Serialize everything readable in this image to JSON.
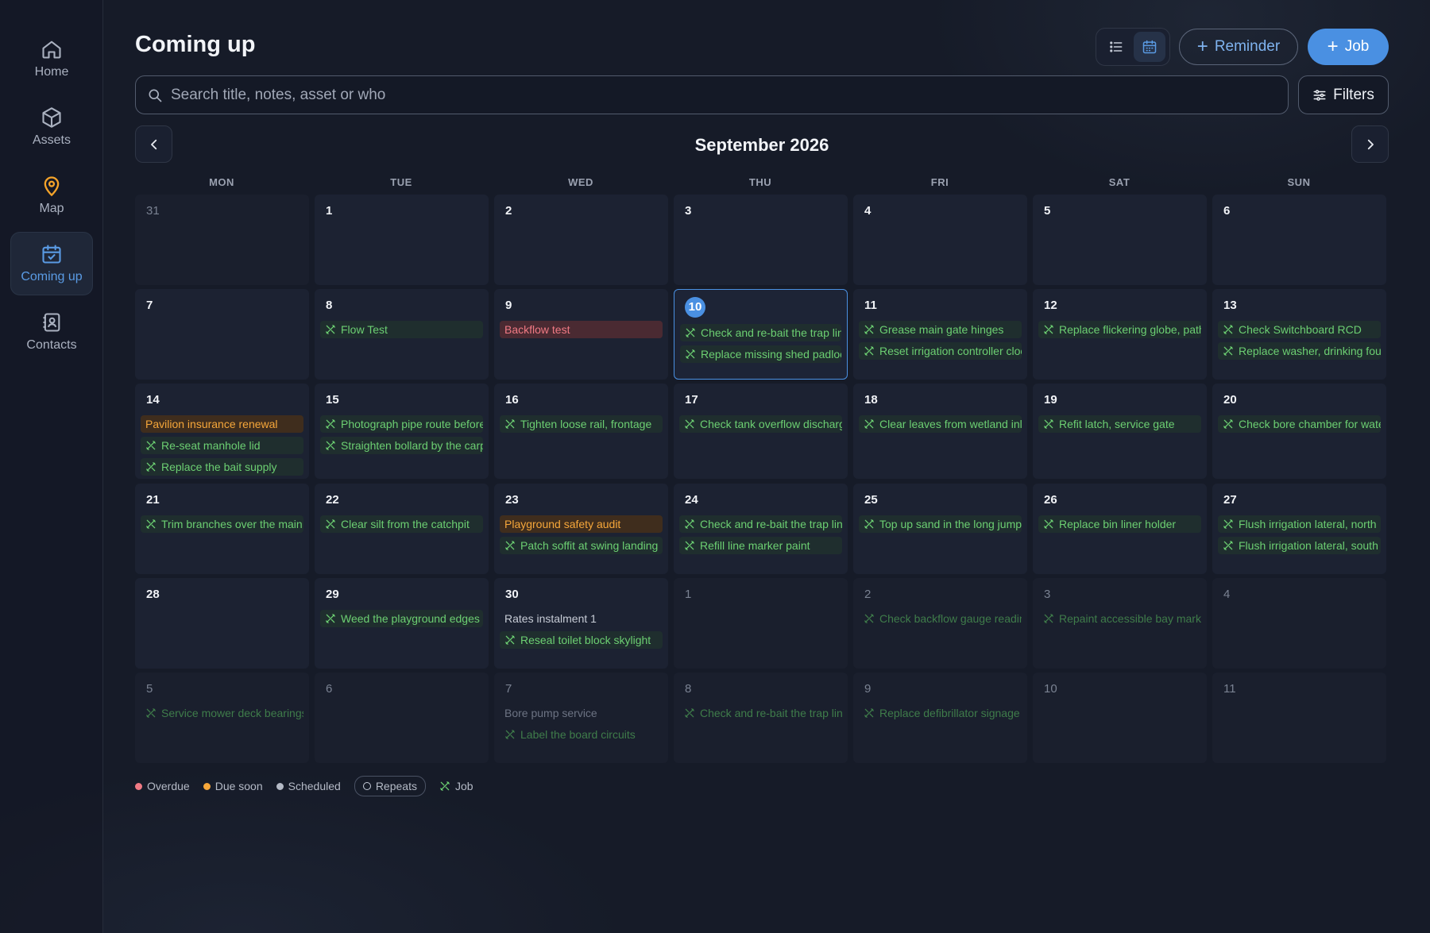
{
  "sidebar": {
    "items": [
      {
        "label": "Home",
        "icon": "home-icon"
      },
      {
        "label": "Assets",
        "icon": "box-icon"
      },
      {
        "label": "Map",
        "icon": "map-pin-icon"
      },
      {
        "label": "Coming up",
        "icon": "calendar-check-icon",
        "active": true
      },
      {
        "label": "Contacts",
        "icon": "contact-book-icon"
      }
    ]
  },
  "header": {
    "title": "Coming up",
    "reminder_label": "Reminder",
    "job_label": "Job",
    "filters_label": "Filters",
    "search_placeholder": "Search title, notes, asset or who",
    "view_modes": [
      "list",
      "calendar"
    ],
    "active_view": "calendar"
  },
  "calendar": {
    "month_label": "September 2026",
    "weekdays": [
      "MON",
      "TUE",
      "WED",
      "THU",
      "FRI",
      "SAT",
      "SUN"
    ],
    "weeks": [
      [
        {
          "d": "31",
          "dim": true,
          "ev": []
        },
        {
          "d": "1",
          "ev": []
        },
        {
          "d": "2",
          "ev": []
        },
        {
          "d": "3",
          "ev": []
        },
        {
          "d": "4",
          "ev": []
        },
        {
          "d": "5",
          "ev": []
        },
        {
          "d": "6",
          "ev": []
        }
      ],
      [
        {
          "d": "7",
          "ev": []
        },
        {
          "d": "8",
          "ev": [
            {
              "t": "Flow Test",
              "k": "job"
            }
          ]
        },
        {
          "d": "9",
          "ev": [
            {
              "t": "Backflow test",
              "k": "overdue"
            }
          ]
        },
        {
          "d": "10",
          "today": true,
          "ev": [
            {
              "t": "Check and re-bait the trap line",
              "k": "job"
            },
            {
              "t": "Replace missing shed padlock",
              "k": "job"
            }
          ]
        },
        {
          "d": "11",
          "ev": [
            {
              "t": "Grease main gate hinges",
              "k": "job"
            },
            {
              "t": "Reset irrigation controller clock",
              "k": "job"
            }
          ]
        },
        {
          "d": "12",
          "ev": [
            {
              "t": "Replace flickering globe, path",
              "k": "job"
            }
          ]
        },
        {
          "d": "13",
          "ev": [
            {
              "t": "Check Switchboard RCD",
              "k": "job"
            },
            {
              "t": "Replace washer, drinking fountain",
              "k": "job"
            }
          ]
        }
      ],
      [
        {
          "d": "14",
          "ev": [
            {
              "t": "Pavilion insurance renewal",
              "k": "due"
            },
            {
              "t": "Re-seat manhole lid",
              "k": "job"
            },
            {
              "t": "Replace the bait supply",
              "k": "job"
            }
          ]
        },
        {
          "d": "15",
          "ev": [
            {
              "t": "Photograph pipe route before",
              "k": "job"
            },
            {
              "t": "Straighten bollard by the carpark",
              "k": "job"
            }
          ]
        },
        {
          "d": "16",
          "ev": [
            {
              "t": "Tighten loose rail, frontage",
              "k": "job"
            }
          ]
        },
        {
          "d": "17",
          "ev": [
            {
              "t": "Check tank overflow discharge",
              "k": "job"
            }
          ]
        },
        {
          "d": "18",
          "ev": [
            {
              "t": "Clear leaves from wetland inlet",
              "k": "job"
            }
          ]
        },
        {
          "d": "19",
          "ev": [
            {
              "t": "Refit latch, service gate",
              "k": "job"
            }
          ]
        },
        {
          "d": "20",
          "ev": [
            {
              "t": "Check bore chamber for water",
              "k": "job"
            }
          ]
        }
      ],
      [
        {
          "d": "21",
          "ev": [
            {
              "t": "Trim branches over the main path",
              "k": "job"
            }
          ]
        },
        {
          "d": "22",
          "ev": [
            {
              "t": "Clear silt from the catchpit",
              "k": "job"
            }
          ]
        },
        {
          "d": "23",
          "ev": [
            {
              "t": "Playground safety audit",
              "k": "due"
            },
            {
              "t": "Patch soffit at swing landing",
              "k": "job"
            }
          ]
        },
        {
          "d": "24",
          "ev": [
            {
              "t": "Check and re-bait the trap line",
              "k": "job"
            },
            {
              "t": "Refill line marker paint",
              "k": "job"
            }
          ]
        },
        {
          "d": "25",
          "ev": [
            {
              "t": "Top up sand in the long jump pit",
              "k": "job"
            }
          ]
        },
        {
          "d": "26",
          "ev": [
            {
              "t": "Replace bin liner holder",
              "k": "job"
            }
          ]
        },
        {
          "d": "27",
          "ev": [
            {
              "t": "Flush irrigation lateral, north",
              "k": "job"
            },
            {
              "t": "Flush irrigation lateral, south",
              "k": "job"
            }
          ]
        }
      ],
      [
        {
          "d": "28",
          "ev": []
        },
        {
          "d": "29",
          "ev": [
            {
              "t": "Weed the playground edges",
              "k": "job"
            }
          ]
        },
        {
          "d": "30",
          "ev": [
            {
              "t": "Rates instalment 1",
              "k": "plain"
            },
            {
              "t": "Reseal toilet block skylight",
              "k": "job"
            }
          ]
        },
        {
          "d": "1",
          "dim": true,
          "ev": []
        },
        {
          "d": "2",
          "dim": true,
          "ev": [
            {
              "t": "Check backflow gauge reading",
              "k": "job"
            }
          ]
        },
        {
          "d": "3",
          "dim": true,
          "ev": [
            {
              "t": "Repaint accessible bay markings",
              "k": "job"
            }
          ]
        },
        {
          "d": "4",
          "dim": true,
          "ev": []
        }
      ],
      [
        {
          "d": "5",
          "dim": true,
          "ev": [
            {
              "t": "Service mower deck bearings",
              "k": "job"
            }
          ]
        },
        {
          "d": "6",
          "dim": true,
          "ev": []
        },
        {
          "d": "7",
          "dim": true,
          "ev": [
            {
              "t": "Bore pump service",
              "k": "plain"
            },
            {
              "t": "Label the board circuits",
              "k": "job"
            }
          ]
        },
        {
          "d": "8",
          "dim": true,
          "ev": [
            {
              "t": "Check and re-bait the trap line",
              "k": "job"
            }
          ]
        },
        {
          "d": "9",
          "dim": true,
          "ev": [
            {
              "t": "Replace defibrillator signage",
              "k": "job"
            }
          ]
        },
        {
          "d": "10",
          "dim": true,
          "ev": []
        },
        {
          "d": "11",
          "dim": true,
          "ev": []
        }
      ]
    ]
  },
  "legend": {
    "overdue": "Overdue",
    "due_soon": "Due soon",
    "scheduled": "Scheduled",
    "repeats": "Repeats",
    "job": "Job"
  },
  "colors": {
    "accent": "#4a90e2",
    "job_green": "#6ccf72",
    "overdue_red": "#f07a84",
    "due_orange": "#f6a73a",
    "scheduled_grey": "#b4bac6"
  }
}
